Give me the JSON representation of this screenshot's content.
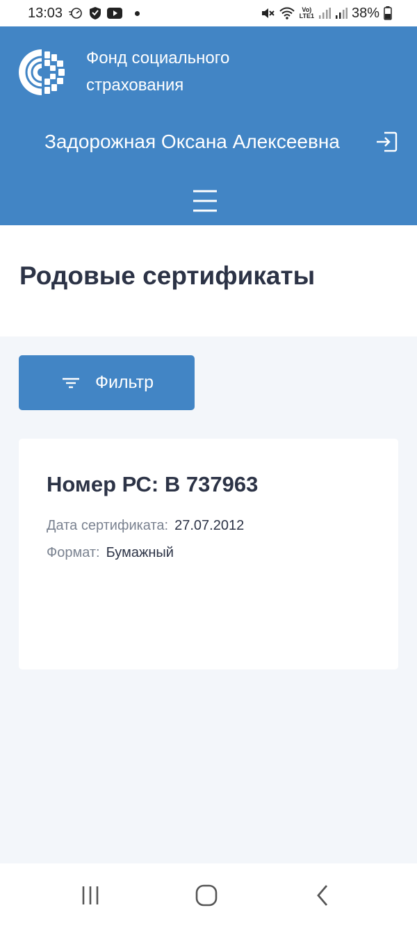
{
  "status_bar": {
    "time": "13:03",
    "battery_percent": "38%",
    "volte_top": "Vo)",
    "volte_bottom": "LTE1",
    "icons": [
      "speedometer-icon",
      "shield-icon",
      "youtube-icon",
      "dot-icon",
      "mute-icon",
      "wifi-icon",
      "signal-icon",
      "battery-icon"
    ]
  },
  "header": {
    "org_name": "Фонд социального страхования",
    "user_name": "Задорожная Оксана Алексеевна",
    "logout_icon": "logout-icon",
    "menu_icon": "hamburger-menu-icon",
    "logo_icon": "fss-logo-icon",
    "background_color": "#4285c5"
  },
  "page": {
    "title": "Родовые сертификаты"
  },
  "filter": {
    "label": "Фильтр",
    "icon": "filter-icon"
  },
  "certificate": {
    "number_label": "Номер РС: В 737963",
    "date_label": "Дата сертификата:",
    "date_value": "27.07.2012",
    "format_label": "Формат:",
    "format_value": "Бумажный"
  },
  "nav_bar": {
    "icons": [
      "recent-apps-icon",
      "home-icon",
      "back-icon"
    ]
  }
}
